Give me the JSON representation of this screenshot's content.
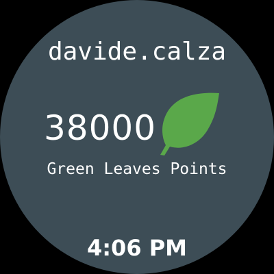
{
  "user": {
    "username": "davide.calza"
  },
  "points": {
    "value": "38000",
    "label": "Green Leaves Points",
    "icon": "leaf-icon"
  },
  "status": {
    "time": "4:06 PM"
  },
  "colors": {
    "background": "#3d4d56",
    "leaf": "#5aa84a",
    "text": "#ffffff"
  }
}
